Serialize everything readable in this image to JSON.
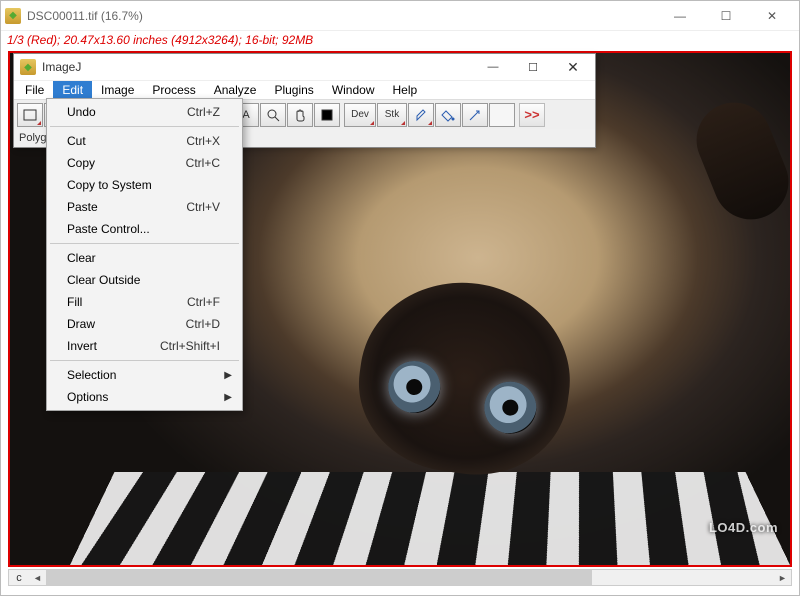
{
  "outer_window": {
    "title": "DSC00011.tif (16.7%)",
    "status_line": "1/3 (Red); 20.47x13.60 inches (4912x3264); 16-bit; 92MB",
    "scroll_label": "c"
  },
  "ij_window": {
    "title": "ImageJ",
    "menus": [
      "File",
      "Edit",
      "Image",
      "Process",
      "Analyze",
      "Plugins",
      "Window",
      "Help"
    ],
    "active_menu_index": 1,
    "status": "Polygon selections",
    "tool_labels": {
      "text": "A",
      "dev": "Dev",
      "stk": "Stk",
      "more": ">>"
    }
  },
  "edit_menu": {
    "items": [
      {
        "label": "Undo",
        "shortcut": "Ctrl+Z"
      },
      {
        "sep": true
      },
      {
        "label": "Cut",
        "shortcut": "Ctrl+X"
      },
      {
        "label": "Copy",
        "shortcut": "Ctrl+C"
      },
      {
        "label": "Copy to System",
        "shortcut": ""
      },
      {
        "label": "Paste",
        "shortcut": "Ctrl+V"
      },
      {
        "label": "Paste Control...",
        "shortcut": ""
      },
      {
        "sep": true
      },
      {
        "label": "Clear",
        "shortcut": ""
      },
      {
        "label": "Clear Outside",
        "shortcut": ""
      },
      {
        "label": "Fill",
        "shortcut": "Ctrl+F"
      },
      {
        "label": "Draw",
        "shortcut": "Ctrl+D"
      },
      {
        "label": "Invert",
        "shortcut": "Ctrl+Shift+I"
      },
      {
        "sep": true
      },
      {
        "label": "Selection",
        "submenu": true
      },
      {
        "label": "Options",
        "submenu": true
      }
    ]
  },
  "watermark": "LO4D.com"
}
